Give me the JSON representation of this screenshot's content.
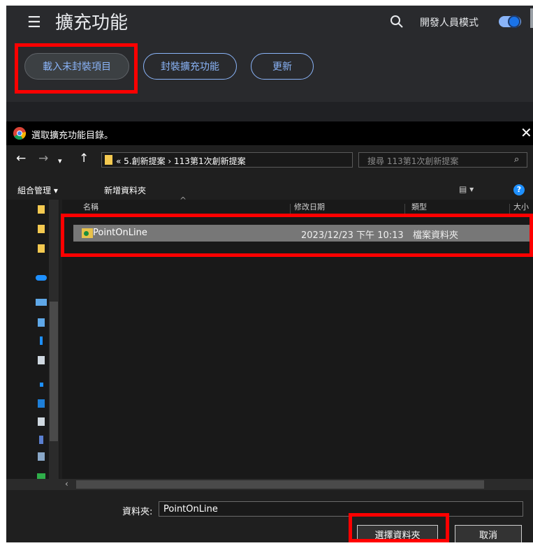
{
  "header": {
    "menu_icon": "hamburger-icon",
    "title": "擴充功能",
    "search_icon": "search-icon",
    "dev_mode_label": "開發人員模式",
    "dev_mode_on": true
  },
  "toolbar": {
    "load_unpacked": "載入未封裝項目",
    "pack_extension": "封裝擴充功能",
    "update": "更新"
  },
  "dialog": {
    "title": "選取擴充功能目錄。",
    "close": "✕",
    "breadcrumb": "« 5.創新提案 › 113第1次創新提案",
    "search_placeholder": "搜尋 113第1次創新提案",
    "organize": "組合管理 ▾",
    "new_folder": "新增資料夾",
    "view_icon": "▤ ▾",
    "help": "?",
    "columns": [
      "名稱",
      "修改日期",
      "類型",
      "大小"
    ],
    "files": [
      {
        "name": "PointOnLine",
        "modified": "2023/12/23 下午 10:13",
        "type": "檔案資料夾"
      }
    ],
    "folder_label": "資料夾:",
    "folder_value": "PointOnLine",
    "select_button": "選擇資料夾",
    "cancel_button": "取消"
  },
  "colors": {
    "highlight": "#ff0000",
    "accent": "#8ab4f8"
  }
}
